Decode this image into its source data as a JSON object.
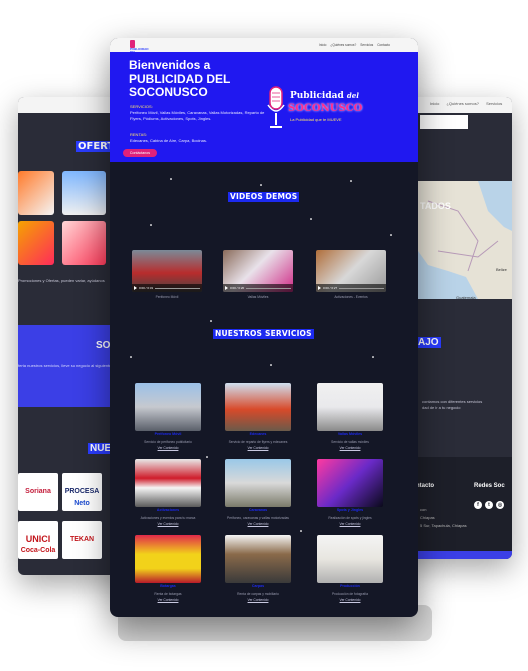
{
  "left_card": {
    "title": "OFERTA",
    "text": "Promociones y Ofertas, pueden variar, ayúdanos",
    "blue_title": "SO",
    "blue_text": "ferta nuestros servicios, lleve su negocio al siguiente nivel",
    "clients_title": "NUE",
    "logos": [
      "Soriana",
      "PROCESA",
      "Neto",
      "UNICI",
      "Coca-Cola",
      "TEKAN"
    ]
  },
  "right_card": {
    "nav": [
      "Inicio",
      "¿Quiénes somos?",
      "Servicios"
    ],
    "map_label": "TADOS",
    "map_places": [
      "Belize",
      "Guatemala"
    ],
    "section": "AJO",
    "text_lines": [
      "contamos con diferentes servicios",
      "dad de ir a tu negocio"
    ],
    "footer": {
      "contact_title": "ntacto",
      "social_title": "Redes Soc",
      "lines": [
        "con",
        "Chiapas",
        "5 Sur, Tapachula, Chiapas"
      ]
    },
    "social_icons": [
      "facebook-icon",
      "twitter-icon",
      "instagram-icon"
    ]
  },
  "main": {
    "header": {
      "logo_text": "PUBLICIDAD DEL SOCONUSCO",
      "nav": [
        "Inicio",
        "¿Quiénes somos?",
        "Servicios",
        "Contacto"
      ]
    },
    "hero": {
      "title": "Bienvenidos a PUBLICIDAD DEL SOCONUSCO",
      "services_label": "SERVICIOS:",
      "services_text": "Perifoneo Móvil, Vallas Móviles, Caravanas, Vallas Motorizadas, Reparto de Flyers, Pódiums, Activaciones, Spots, Jingles.",
      "rentals_label": "RENTAS:",
      "rentals_text": "Edecanes, Cabina de Aire, Carpa, Bocinas.",
      "button": "Contáctanos",
      "logo_line1": "Publicidad",
      "logo_del": "del",
      "logo_line2": "SOCONUSCO",
      "logo_tagline": "La Publicidad que te MUEVE"
    },
    "videos": {
      "title": "VIDEOS DEMOS",
      "items": [
        {
          "time": "0:00 / 0:31",
          "caption": "Perifoneo Móvil"
        },
        {
          "time": "0:00 / 0:20",
          "caption": "Vallas Móviles"
        },
        {
          "time": "0:00 / 0:27",
          "caption": "Activaciones - Eventos"
        }
      ]
    },
    "services": {
      "title": "NUESTROS SERVICIOS",
      "items": [
        {
          "title": "Perifoneo Móvil",
          "desc": "Servicio de perifoneo publicitario",
          "link": "Ver Contenido"
        },
        {
          "title": "Edecanes",
          "desc": "Servicio de reparto de flyers y edecanes",
          "link": "Ver Contenido"
        },
        {
          "title": "Vallas Móviles",
          "desc": "Servicio de vallas móviles",
          "link": "Ver Contenido"
        },
        {
          "title": "Activaciones",
          "desc": "Activaciones y eventos para tu marca",
          "link": "Ver Contenido"
        },
        {
          "title": "Caravanas",
          "desc": "Perifoneo, caravanas y vallas motorizadas",
          "link": "Ver Contenido"
        },
        {
          "title": "Spots y Jingles",
          "desc": "Realización de spots y jingles",
          "link": "Ver Contenido"
        },
        {
          "title": "Botargas",
          "desc": "Renta de botargas",
          "link": "Ver Contenido"
        },
        {
          "title": "Carpas",
          "desc": "Renta de carpas y mobiliario",
          "link": "Ver Contenido"
        },
        {
          "title": "Producción",
          "desc": "Producción de fotografía",
          "link": "Ver Contenido"
        }
      ]
    }
  },
  "colors": {
    "brand_blue": "#2018f0",
    "accent_pink": "#e0217a",
    "dark_bg": "#141726"
  }
}
